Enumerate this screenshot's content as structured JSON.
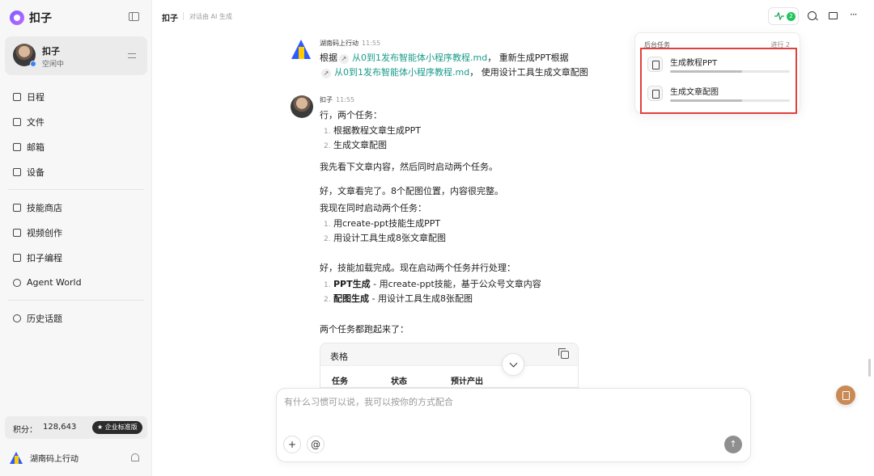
{
  "app": {
    "name": "扣子"
  },
  "profile": {
    "name": "扣子",
    "status": "空闲中"
  },
  "nav": {
    "group1": [
      "日程",
      "文件",
      "邮箱",
      "设备"
    ],
    "group2": [
      "技能商店",
      "视频创作",
      "扣子编程",
      "Agent World"
    ],
    "group3": [
      "历史话题"
    ]
  },
  "points": {
    "label": "积分：",
    "value": "128,643",
    "edition": "★ 企业标准版"
  },
  "org": {
    "name": "湖南码上行动"
  },
  "header": {
    "title": "扣子",
    "subtitle": "对话由 AI 生成",
    "activity_count": "2",
    "more": "···"
  },
  "tasks": {
    "title": "后台任务",
    "count": "进行 2",
    "items": [
      {
        "label": "生成教程PPT",
        "progress": 0.6
      },
      {
        "label": "生成文章配图",
        "progress": 0.6
      }
    ]
  },
  "messages": {
    "m1": {
      "sender": "湖南码上行动",
      "time": "11:55",
      "p1": "根据",
      "link1": "从0到1发布智能体小程序教程.md",
      "p2": "， 重新生成PPT根据",
      "link2": "从0到1发布智能体小程序教程.md",
      "p3": "， 使用设计工具生成文章配图"
    },
    "m2": {
      "sender": "扣子",
      "time": "11:55",
      "intro": "行，两个任务：",
      "list1": [
        "根据教程文章生成PPT",
        "生成文章配图"
      ],
      "line1": "我先看下文章内容，然后同时启动两个任务。",
      "line2": "好，文章看完了。8个配图位置，内容很完整。",
      "line3": "我现在同时启动两个任务：",
      "list2": [
        "用create-ppt技能生成PPT",
        "用设计工具生成8张文章配图"
      ],
      "line4": "好，技能加载完成。现在启动两个任务并行处理：",
      "list3": [
        {
          "bold": "PPT生成",
          "rest": " - 用create-ppt技能，基于公众号文章内容"
        },
        {
          "bold": "配图生成",
          "rest": " - 用设计工具生成8张配图"
        }
      ],
      "line5": "两个任务都跑起来了：",
      "table": {
        "title": "表格",
        "columns": [
          "任务",
          "状态",
          "预计产出"
        ]
      }
    }
  },
  "composer": {
    "placeholder": "有什么习惯可以说，我可以按你的方式配合",
    "value": "",
    "add": "+",
    "mention": "@",
    "send": "↑"
  }
}
